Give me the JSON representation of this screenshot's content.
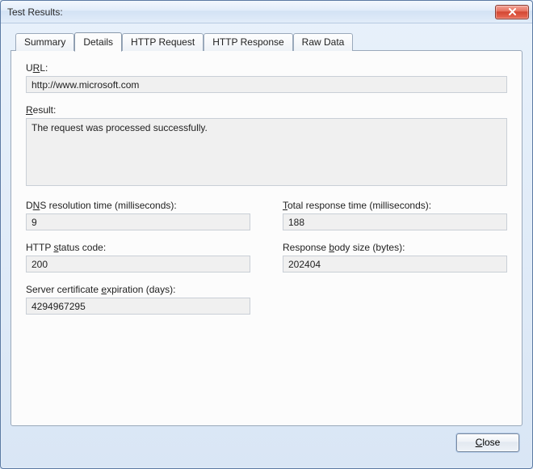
{
  "window": {
    "title": "Test Results:"
  },
  "tabs": {
    "summary": "Summary",
    "details": "Details",
    "http_request": "HTTP Request",
    "http_response": "HTTP Response",
    "raw_data": "Raw Data",
    "active": "details"
  },
  "details": {
    "url_label_pre": "U",
    "url_label_ul": "R",
    "url_label_post": "L:",
    "url_value": "http://www.microsoft.com",
    "result_label_ul": "R",
    "result_label_post": "esult:",
    "result_value": "The request was processed successfully.",
    "dns_label_pre": "D",
    "dns_label_ul": "N",
    "dns_label_post": "S resolution time (milliseconds):",
    "dns_value": "9",
    "total_label_ul": "T",
    "total_label_post": "otal response time (milliseconds):",
    "total_value": "188",
    "status_label_pre": "HTTP ",
    "status_label_ul": "s",
    "status_label_post": "tatus code:",
    "status_value": "200",
    "body_label_pre": "Response ",
    "body_label_ul": "b",
    "body_label_post": "ody size (bytes):",
    "body_value": "202404",
    "cert_label_pre": "Server certificate ",
    "cert_label_ul": "e",
    "cert_label_post": "xpiration (days):",
    "cert_value": "4294967295"
  },
  "footer": {
    "close_ul": "C",
    "close_post": "lose"
  }
}
